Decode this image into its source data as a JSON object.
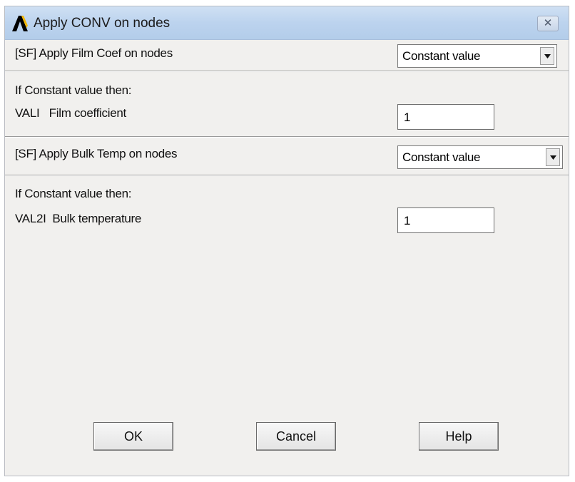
{
  "window": {
    "title": "Apply CONV on nodes",
    "close_glyph": "✕"
  },
  "film": {
    "label": "[SF] Apply Film Coef on nodes",
    "selected": "Constant value",
    "condition": "If Constant value then:",
    "field_label": "VALI   Film coefficient",
    "value": "1"
  },
  "bulk": {
    "label": "[SF] Apply Bulk Temp on nodes",
    "selected": "Constant value",
    "condition": "If Constant value then:",
    "field_label": "VAL2I  Bulk temperature",
    "value": "1"
  },
  "buttons": {
    "ok": "OK",
    "cancel": "Cancel",
    "help": "Help"
  },
  "icons": {
    "app": "ansys-logo-icon",
    "close": "close-icon",
    "dropdown": "chevron-down-icon"
  }
}
